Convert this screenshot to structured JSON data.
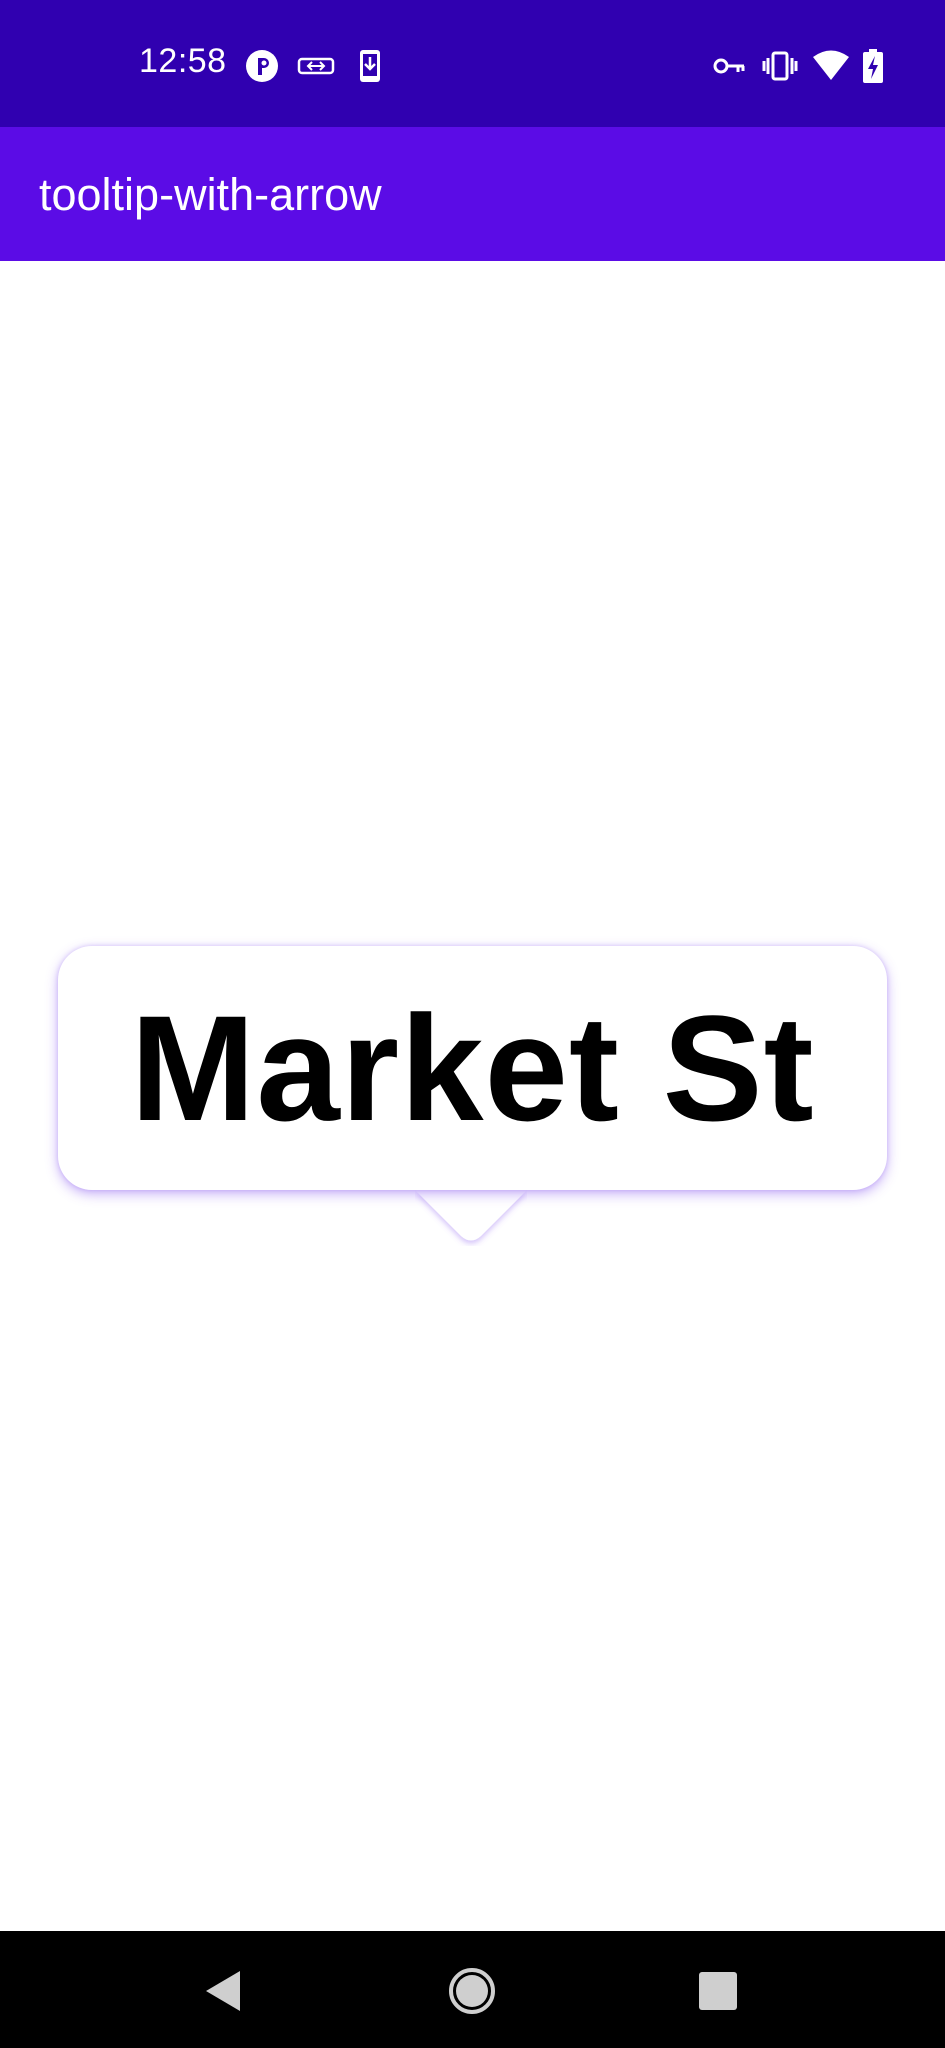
{
  "status_bar": {
    "time": "12:58",
    "background": "#3000b0",
    "left_icons": [
      "app-notification-icon",
      "vpn-tunnel-icon",
      "download-icon"
    ],
    "right_icons": [
      "key-icon",
      "vibrate-icon",
      "wifi-icon",
      "battery-charging-icon"
    ]
  },
  "app_bar": {
    "title": "tooltip-with-arrow",
    "background": "#5b0ce6"
  },
  "tooltip": {
    "text": "Market St",
    "shadow_color": "#8250f0"
  },
  "nav_bar": {
    "buttons": [
      "back-icon",
      "home-icon",
      "recents-icon"
    ]
  }
}
